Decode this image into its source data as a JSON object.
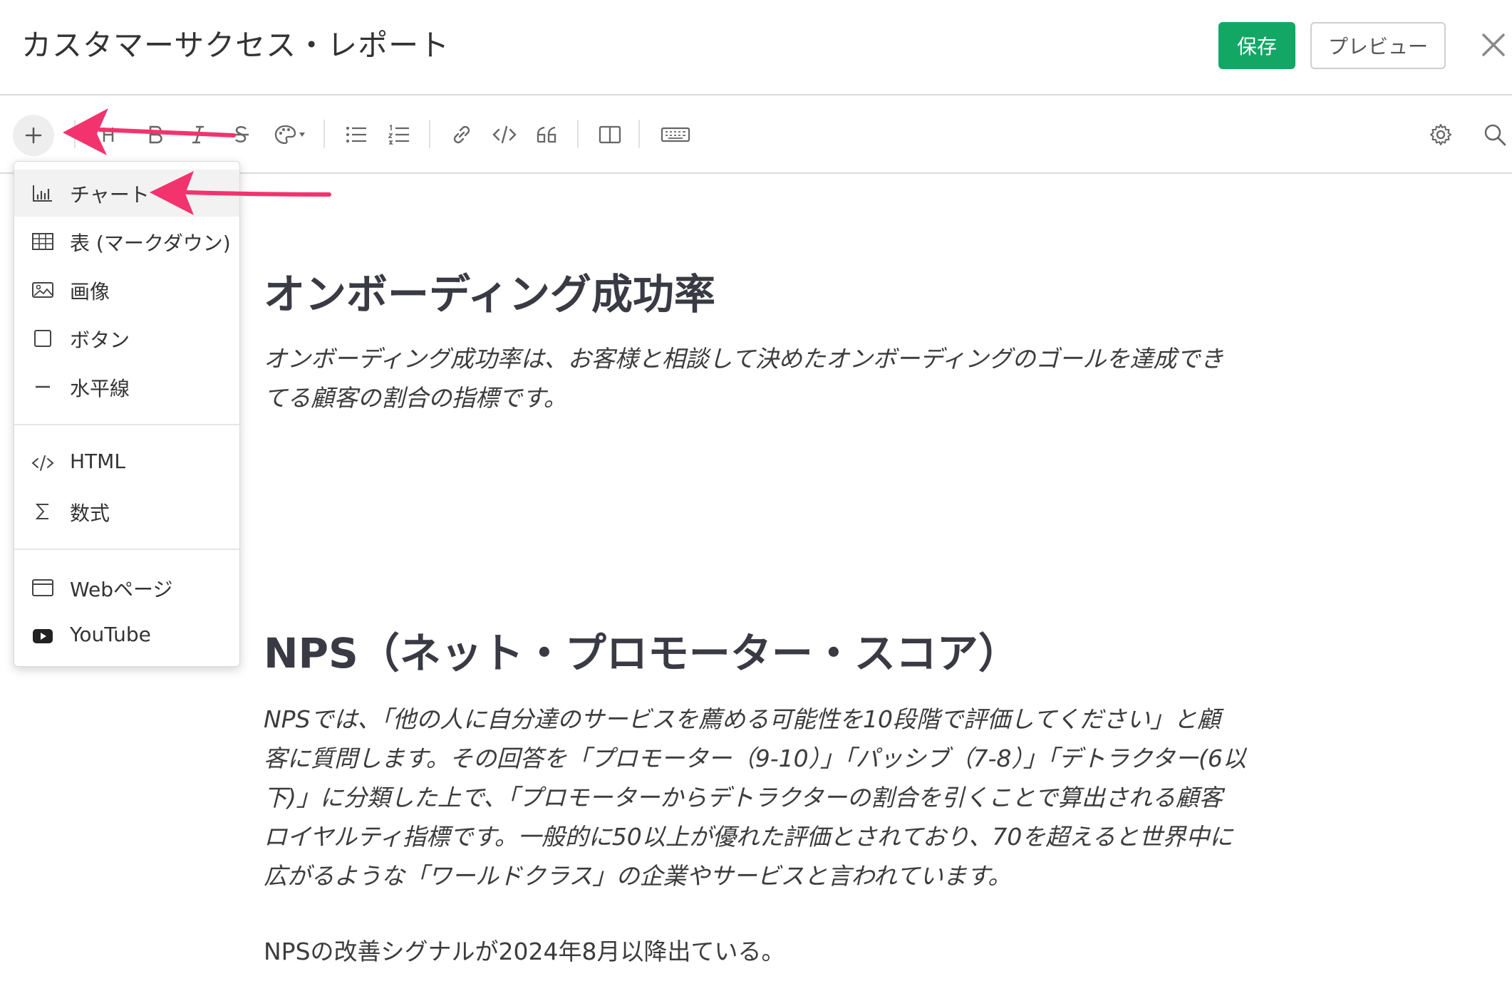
{
  "header": {
    "title": "カスタマーサクセス・レポート",
    "save_label": "保存",
    "preview_label": "プレビュー"
  },
  "toolbar": {
    "tools": [
      "plus-icon",
      "heading-icon",
      "bold-icon",
      "italic-icon",
      "strikethrough-icon",
      "palette-icon",
      "bulleted-list-icon",
      "numbered-list-icon",
      "link-icon",
      "code-icon",
      "quote-icon",
      "columns-icon",
      "keyboard-icon",
      "gear-icon",
      "search-icon"
    ]
  },
  "menu": {
    "items": [
      {
        "label": "チャート",
        "icon": "bar-chart-icon"
      },
      {
        "label": "表 (マークダウン)",
        "icon": "table-icon"
      },
      {
        "label": "画像",
        "icon": "image-icon"
      },
      {
        "label": "ボタン",
        "icon": "button-icon"
      },
      {
        "label": "水平線",
        "icon": "horizontal-line-icon"
      },
      {
        "label": "HTML",
        "icon": "code-icon"
      },
      {
        "label": "数式",
        "icon": "sigma-icon"
      },
      {
        "label": "Webページ",
        "icon": "browser-icon"
      },
      {
        "label": "YouTube",
        "icon": "youtube-icon"
      }
    ]
  },
  "content": {
    "section1": {
      "heading": "オンボーディング成功率",
      "lines": [
        "オンボーディング成功率は、お客様と相談して決めたオンボーディングのゴールを達成でき",
        "てる顧客の割合の指標です。"
      ]
    },
    "section2": {
      "heading": "NPS（ネット・プロモーター・スコア）",
      "lines": [
        "NPSでは、「他の人に自分達のサービスを薦める可能性を10段階で評価してください」と顧",
        "客に質問します。その回答を「プロモーター（9-10）」「パッシブ（7-8）」「デトラクター(6以",
        "下)」に分類した上で、「プロモーターからデトラクターの割合を引くことで算出される顧客",
        "ロイヤルティ指標です。一般的に50以上が優れた評価とされており、70を超えると世界中に",
        "広がるような「ワールドクラス」の企業やサービスと言われています。"
      ],
      "note": "NPSの改善シグナルが2024年8月以降出ている。"
    }
  },
  "colors": {
    "accent_green": "#12a765",
    "annotation_arrow": "#f2336e"
  }
}
